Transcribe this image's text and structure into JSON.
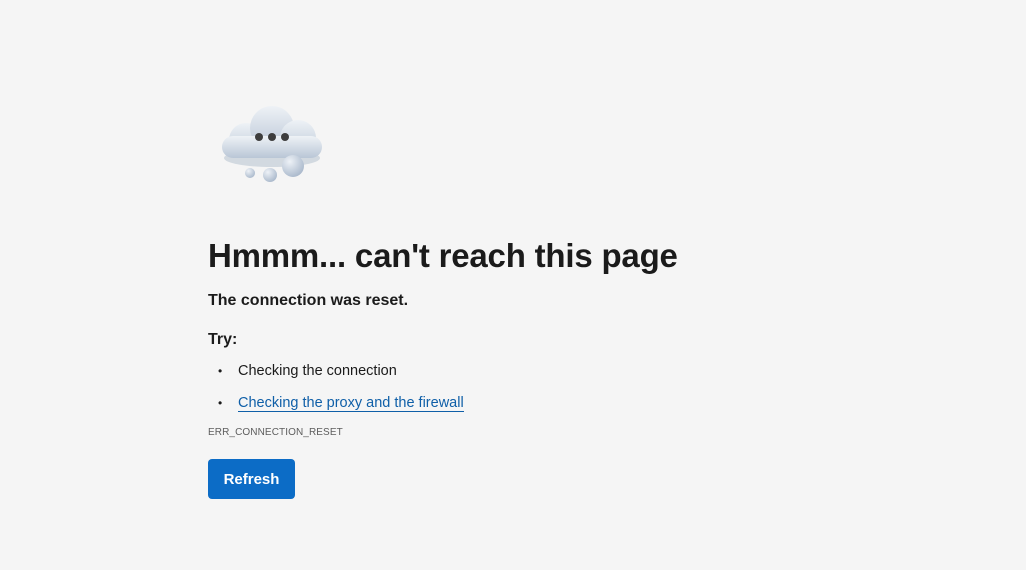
{
  "illustration": {
    "icon": "cloud-thinking-icon"
  },
  "error": {
    "heading": "Hmmm... can't reach this page",
    "subtitle": "The connection was reset.",
    "try_label": "Try:",
    "suggestions": [
      {
        "text": "Checking the connection",
        "is_link": false
      },
      {
        "text": "Checking the proxy and the firewall",
        "is_link": true
      }
    ],
    "code": "ERR_CONNECTION_RESET"
  },
  "actions": {
    "refresh_label": "Refresh"
  },
  "colors": {
    "background": "#f5f5f5",
    "accent": "#0c6cc6",
    "link": "#0f5fa8"
  }
}
